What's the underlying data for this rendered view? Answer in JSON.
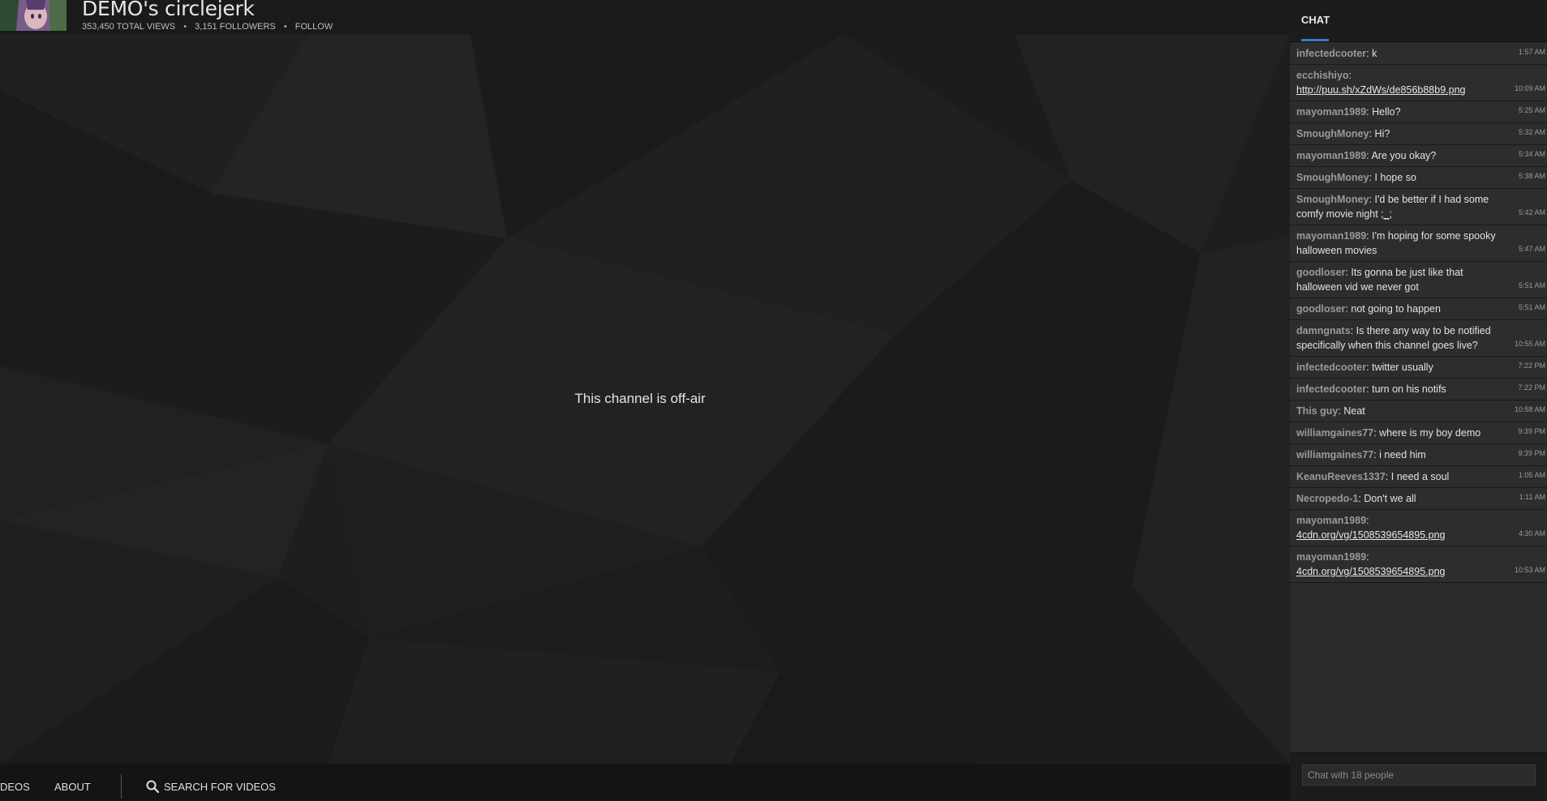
{
  "header": {
    "title": "DEMO's circlejerk",
    "total_views": "353,450 TOTAL VIEWS",
    "followers": "3,151 FOLLOWERS",
    "separator": "•",
    "follow_label": "FOLLOW"
  },
  "player": {
    "status_text": "This channel is off-air"
  },
  "bottom_nav": {
    "videos_label": "DEOS",
    "about_label": "ABOUT",
    "search_label": "SEARCH FOR VIDEOS"
  },
  "chat": {
    "tab_label": "CHAT",
    "input_placeholder": "Chat with 18 people",
    "accent_color": "#3b7ac9",
    "messages": [
      {
        "user": "infectedcooter",
        "text": "k",
        "time": "1:57 AM"
      },
      {
        "user": "ecchishiyo",
        "text": "",
        "link": "http://puu.sh/xZdWs/de856b88b9.png",
        "time": "10:09 AM"
      },
      {
        "user": "mayoman1989",
        "text": "Hello?",
        "time": "5:25 AM"
      },
      {
        "user": "SmoughMoney",
        "text": "Hi?",
        "time": "5:32 AM"
      },
      {
        "user": "mayoman1989",
        "text": "Are you okay?",
        "time": "5:34 AM"
      },
      {
        "user": "SmoughMoney",
        "text": "I hope so",
        "time": "5:38 AM"
      },
      {
        "user": "SmoughMoney",
        "text": "I'd be better if I had some comfy movie night ",
        "link": ";_;",
        "time": "5:42 AM"
      },
      {
        "user": "mayoman1989",
        "text": "I'm hoping for some spooky halloween movies",
        "time": "5:47 AM"
      },
      {
        "user": "goodloser",
        "text": "Its gonna be just like that halloween vid we never got",
        "time": "5:51 AM"
      },
      {
        "user": "goodloser",
        "text": "not going to happen",
        "time": "5:51 AM"
      },
      {
        "user": "damngnats",
        "text": "Is there any way to be notified specifically when this channel goes live?",
        "time": "10:55 AM"
      },
      {
        "user": "infectedcooter",
        "text": "twitter usually",
        "time": "7:22 PM"
      },
      {
        "user": "infectedcooter",
        "text": "turn on his notifs",
        "time": "7:22 PM"
      },
      {
        "user": "This guy",
        "text": "Neat",
        "time": "10:58 AM"
      },
      {
        "user": "williamgaines77",
        "text": "where is my boy demo",
        "time": "9:39 PM"
      },
      {
        "user": "williamgaines77",
        "text": "i need him",
        "time": "9:39 PM"
      },
      {
        "user": "KeanuReeves1337",
        "text": "I need a soul",
        "time": "1:05 AM"
      },
      {
        "user": "Necropedo-1",
        "text": "Don't we all",
        "time": "1:11 AM"
      },
      {
        "user": "mayoman1989",
        "text": "",
        "link": "4cdn.org/vg/1508539654895.png",
        "time": "4:30 AM"
      },
      {
        "user": "mayoman1989",
        "text": "",
        "link": "4cdn.org/vg/1508539654895.png",
        "time": "10:53 AM"
      }
    ]
  }
}
